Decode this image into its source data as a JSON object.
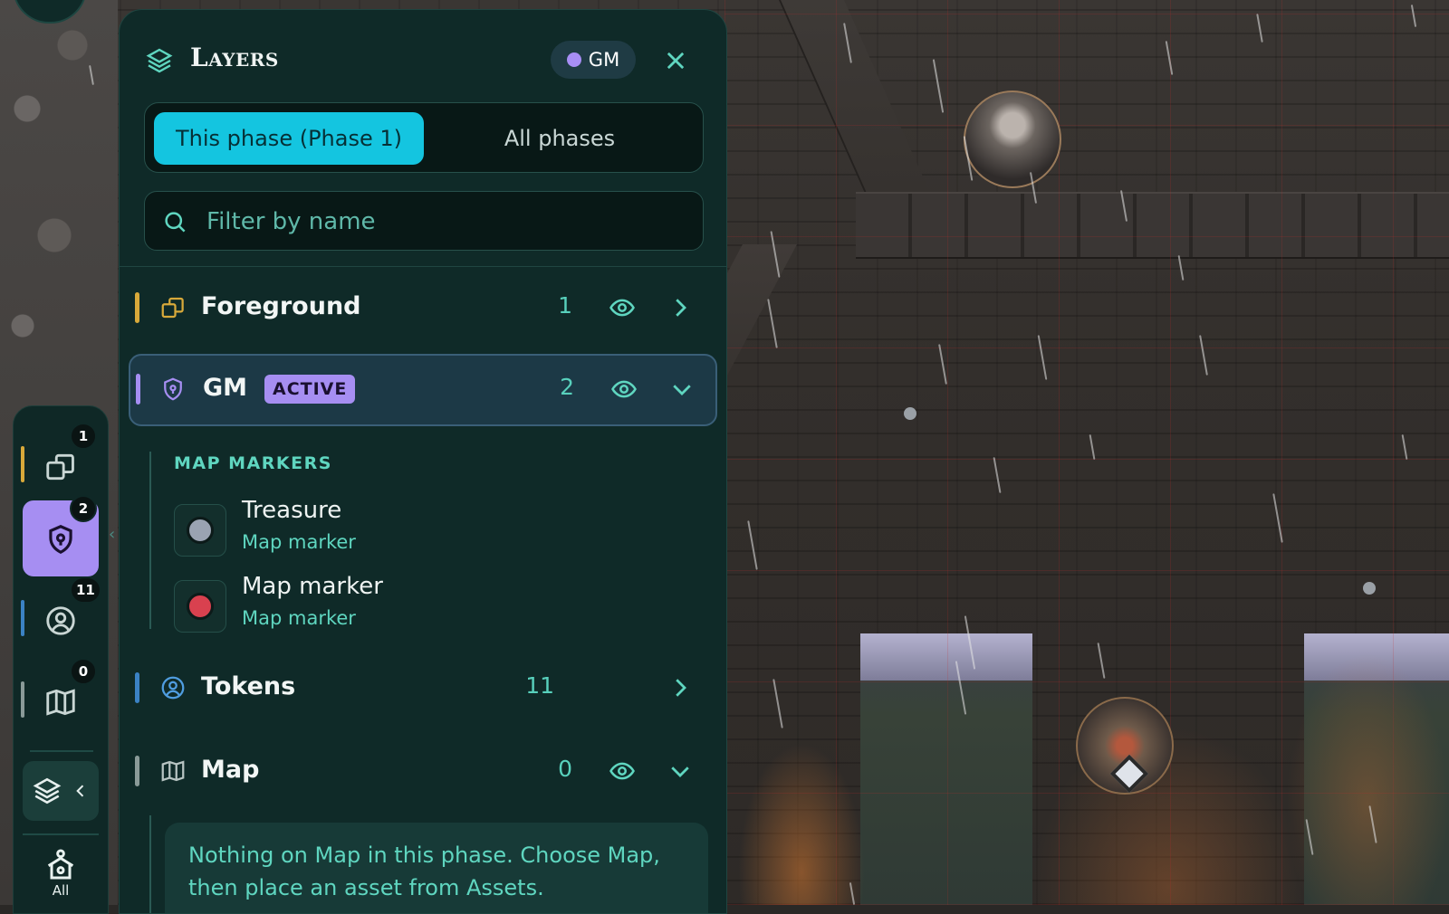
{
  "panel": {
    "title": "Layers",
    "role_pill": "GM",
    "close_icon": "close-icon",
    "phase_toggle": {
      "active": "This phase (Phase 1)",
      "inactive": "All phases"
    },
    "search": {
      "placeholder": "Filter by name",
      "value": ""
    },
    "layers": [
      {
        "name": "Foreground",
        "count": "1",
        "visible": true,
        "expanded": false,
        "icon": "foreground-icon",
        "color": "#d8a93a"
      },
      {
        "name": "GM",
        "badge": "ACTIVE",
        "count": "2",
        "visible": true,
        "expanded": true,
        "active": true,
        "icon": "shield-icon",
        "color": "#a68ef2"
      },
      {
        "name": "Tokens",
        "count": "11",
        "visible": false,
        "expanded": false,
        "icon": "user-circle-icon",
        "color": "#3b82c4"
      },
      {
        "name": "Map",
        "count": "0",
        "visible": true,
        "expanded": true,
        "icon": "map-icon",
        "color": "#8a9a98"
      }
    ],
    "gm_section": {
      "label": "MAP MARKERS",
      "items": [
        {
          "name": "Treasure",
          "type": "Map marker",
          "color": "#9aa3b2"
        },
        {
          "name": "Map marker",
          "type": "Map marker",
          "color": "#d9414f"
        }
      ]
    },
    "map_empty_note": "Nothing on Map in this phase. Choose Map, then place an asset from Assets."
  },
  "rail": {
    "items": [
      {
        "icon": "foreground-icon",
        "badge": "1",
        "color": "#d8a93a"
      },
      {
        "icon": "shield-icon",
        "badge": "2",
        "color": "#a68ef2",
        "active": true
      },
      {
        "icon": "user-circle-icon",
        "badge": "11",
        "color": "#3b82c4"
      },
      {
        "icon": "map-icon",
        "badge": "0",
        "color": "#8a9a98"
      }
    ],
    "layers_toggle_icon": "layers-icon",
    "all_label": "All"
  },
  "colors": {
    "accent_cyan": "#14c5e0",
    "accent_purple": "#a68ef2",
    "teal_text": "#5fd6c0",
    "panel_bg": "#0f2a28"
  }
}
